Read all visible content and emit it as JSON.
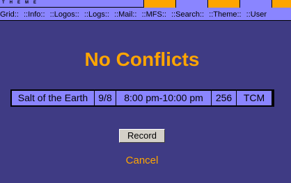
{
  "theme_bar": {
    "label": "THEME"
  },
  "nav": {
    "items": [
      "Grid::",
      "::Info::",
      "::Logos::",
      "::Logs::",
      "::Mail::",
      "::MFS::",
      "::Search::",
      "::Theme::",
      "::User"
    ]
  },
  "title": "No Conflicts",
  "program": {
    "title": "Salt of the Earth",
    "date": "9/8",
    "time": "8:00 pm-10:00 pm",
    "channel": "256",
    "network": "TCM"
  },
  "actions": {
    "record_label": "Record",
    "cancel_label": "Cancel"
  },
  "colors": {
    "background": "#3f3b84",
    "bar": "#8a85ff",
    "accent": "#ffa500"
  }
}
